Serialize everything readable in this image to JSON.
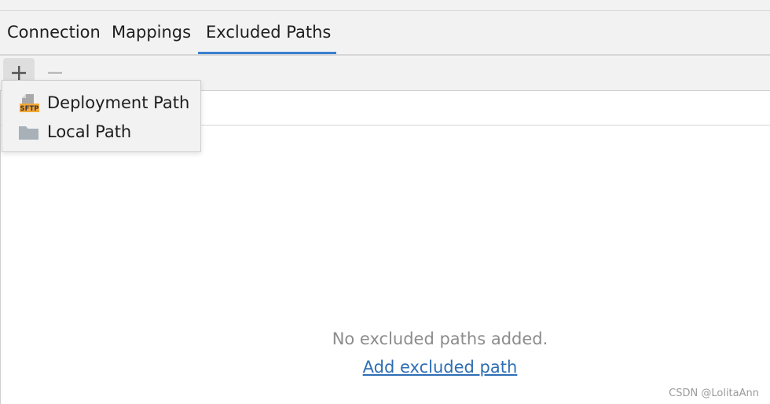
{
  "tabs": [
    {
      "label": "Connection"
    },
    {
      "label": "Mappings"
    },
    {
      "label": "Excluded Paths",
      "active": true
    }
  ],
  "toolbar": {
    "add_icon": "plus-icon",
    "remove_icon": "minus-icon"
  },
  "popup_menu": {
    "items": [
      {
        "label": "Deployment Path",
        "icon": "sftp-icon",
        "icon_text": "SFTP"
      },
      {
        "label": "Local Path",
        "icon": "folder-icon"
      }
    ]
  },
  "empty_state": {
    "message": "No excluded paths added.",
    "link": "Add excluded path"
  },
  "watermark": "CSDN @LolitaAnn",
  "colors": {
    "accent": "#3b7fd0",
    "link": "#2e6db4",
    "muted_text": "#8c8c8c",
    "sftp_badge": "#f4a736"
  }
}
